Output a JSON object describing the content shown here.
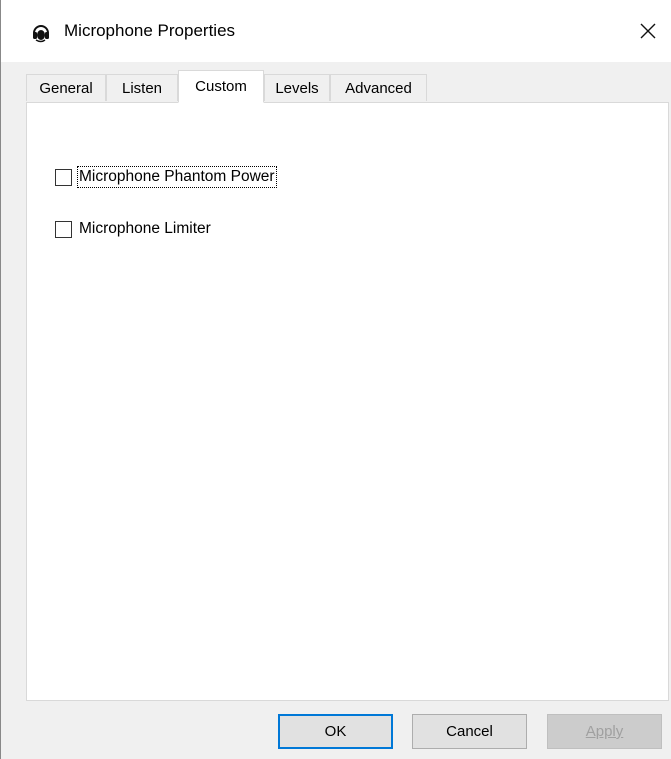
{
  "window": {
    "title": "Microphone Properties",
    "icon": "microphone-headset-icon",
    "close_icon": "close-icon"
  },
  "tabs": [
    {
      "label": "General",
      "active": false
    },
    {
      "label": "Listen",
      "active": false
    },
    {
      "label": "Custom",
      "active": true
    },
    {
      "label": "Levels",
      "active": false
    },
    {
      "label": "Advanced",
      "active": false
    }
  ],
  "custom": {
    "options": [
      {
        "label": "Microphone Phantom Power",
        "checked": false,
        "focused": true
      },
      {
        "label": "Microphone Limiter",
        "checked": false,
        "focused": false
      }
    ]
  },
  "buttons": {
    "ok": "OK",
    "cancel": "Cancel",
    "apply": "Apply"
  },
  "colors": {
    "focus_blue": "#0078d7",
    "panel_bg": "#ffffff",
    "window_bg": "#f0f0f0"
  }
}
